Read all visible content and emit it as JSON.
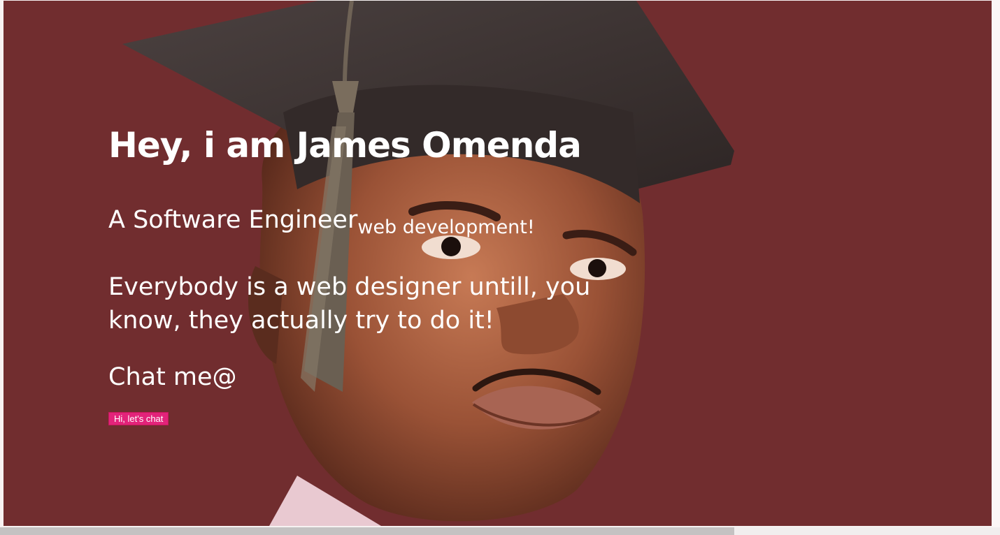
{
  "hero": {
    "title": "Hey, i am James Omenda",
    "role_main": "A Software Engineer",
    "role_sub": "web development!",
    "quote": "Everybody is a web designer untill, you know, they actually try to do it!",
    "chat_label": "Chat me@",
    "chat_button": "Hi, let's chat",
    "background_color": "#712d2f",
    "button_color": "#e3237a"
  },
  "photo": {
    "icon": "graduate-portrait-image"
  }
}
